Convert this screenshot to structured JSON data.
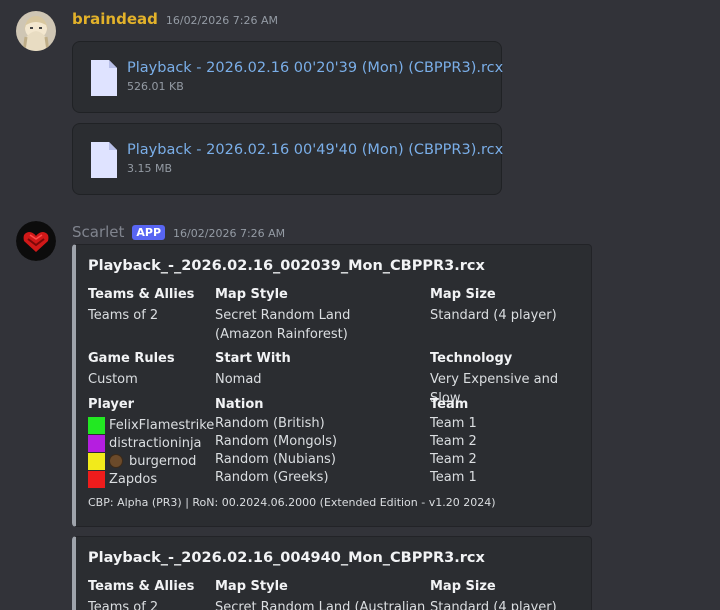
{
  "messages": [
    {
      "author": "braindead",
      "timestamp": "16/02/2026 7:26 AM",
      "attachments": [
        {
          "name": "Playback - 2026.02.16 00'20'39 (Mon) (CBPPR3).rcx",
          "size": "526.01 KB",
          "icon": "file-icon"
        },
        {
          "name": "Playback - 2026.02.16 00'49'40 (Mon) (CBPPR3).rcx",
          "size": "3.15 MB",
          "icon": "file-icon"
        }
      ]
    },
    {
      "author": "Scarlet",
      "badge": "APP",
      "timestamp": "16/02/2026 7:26 AM",
      "embeds": [
        {
          "title": "Playback_-_2026.02.16_002039_Mon_CBPPR3.rcx",
          "fields": {
            "teams_label": "Teams & Allies",
            "teams_value": "Teams of 2",
            "map_style_label": "Map Style",
            "map_style_value": "Secret Random Land (Amazon Rainforest)",
            "map_size_label": "Map Size",
            "map_size_value": "Standard (4 player)",
            "rules_label": "Game Rules",
            "rules_value": "Custom",
            "start_label": "Start With",
            "start_value": "Nomad",
            "tech_label": "Technology",
            "tech_value": "Very Expensive and Slow",
            "player_label": "Player",
            "nation_label": "Nation",
            "team_label": "Team"
          },
          "players": [
            {
              "name": "FelixFlamestrike",
              "color": "#22e822",
              "nation": "Random (British)",
              "team": "Team 1"
            },
            {
              "name": "distractioninja",
              "color": "#b51ee0",
              "nation": "Random (Mongols)",
              "team": "Team 2"
            },
            {
              "name": "burgernod",
              "color": "#f2ea1b",
              "nation": "Random (Nubians)",
              "team": "Team 2"
            },
            {
              "name": "Zapdos",
              "color": "#ef1c1c",
              "nation": "Random (Greeks)",
              "team": "Team 1"
            }
          ],
          "footer": "CBP: Alpha  (PR3)  |  RoN: 00.2024.06.2000 (Extended Edition - v1.20 2024)"
        },
        {
          "title": "Playback_-_2026.02.16_004940_Mon_CBPPR3.rcx",
          "fields": {
            "teams_label": "Teams & Allies",
            "teams_value": "Teams of 2",
            "map_style_label": "Map Style",
            "map_style_value": "Secret Random Land (Australian",
            "map_size_label": "Map Size",
            "map_size_value": "Standard (4 player)"
          }
        }
      ]
    }
  ],
  "colors": {
    "background": "#323339",
    "embed_bg": "#2b2d31",
    "link": "#7aaee8",
    "author_braindead": "#e3b22a",
    "app_badge": "#5865f2"
  }
}
